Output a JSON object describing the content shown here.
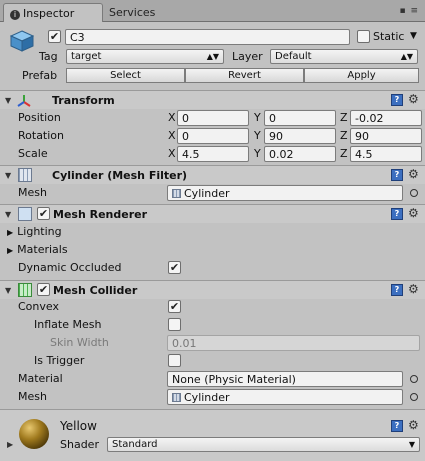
{
  "tabs": {
    "inspector": "Inspector",
    "services": "Services"
  },
  "header": {
    "name": "C3",
    "static_label": "Static",
    "tag_label": "Tag",
    "tag_value": "target",
    "layer_label": "Layer",
    "layer_value": "Default",
    "prefab_label": "Prefab",
    "select": "Select",
    "revert": "Revert",
    "apply": "Apply"
  },
  "transform": {
    "title": "Transform",
    "position_label": "Position",
    "rotation_label": "Rotation",
    "scale_label": "Scale",
    "position": {
      "x": "0",
      "y": "0",
      "z": "-0.02"
    },
    "rotation": {
      "x": "0",
      "y": "90",
      "z": "90"
    },
    "scale": {
      "x": "4.5",
      "y": "0.02",
      "z": "4.5"
    },
    "axis_x": "X",
    "axis_y": "Y",
    "axis_z": "Z"
  },
  "mesh_filter": {
    "title": "Cylinder (Mesh Filter)",
    "mesh_label": "Mesh",
    "mesh_value": "Cylinder"
  },
  "mesh_renderer": {
    "title": "Mesh Renderer",
    "lighting": "Lighting",
    "materials": "Materials",
    "dynamic_occluded": "Dynamic Occluded"
  },
  "mesh_collider": {
    "title": "Mesh Collider",
    "convex": "Convex",
    "inflate_mesh": "Inflate Mesh",
    "skin_width_label": "Skin Width",
    "skin_width_value": "0.01",
    "is_trigger": "Is Trigger",
    "material_label": "Material",
    "material_value": "None (Physic Material)",
    "mesh_label": "Mesh",
    "mesh_value": "Cylinder"
  },
  "material": {
    "name": "Yellow",
    "shader_label": "Shader",
    "shader_value": "Standard"
  },
  "colors": {
    "help_icon": "#3c6fc0",
    "background": "#c2c2c2"
  }
}
